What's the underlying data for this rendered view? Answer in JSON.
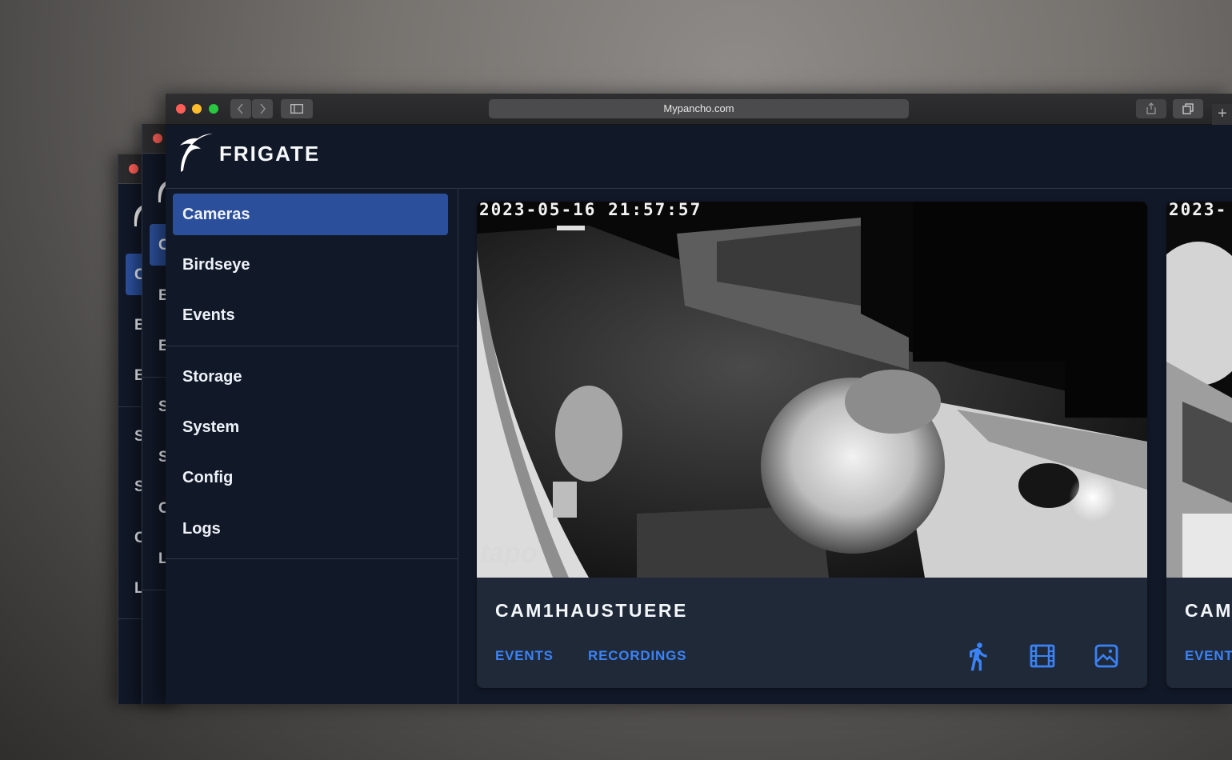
{
  "browser": {
    "url": "Mypancho.com",
    "back_icon": "chevron-left-icon",
    "forward_icon": "chevron-right-icon",
    "sidebar_toggle_icon": "sidebar-icon",
    "share_icon": "share-icon",
    "tabs_icon": "tabs-overview-icon",
    "new_tab_label": "+",
    "traffic_lights": {
      "close": "#ff5f57",
      "minimize": "#febc2e",
      "zoom": "#28c840"
    }
  },
  "app": {
    "name": "FRIGATE",
    "logo_icon": "frigate-bird-icon"
  },
  "colors": {
    "accent": "#3b82f6",
    "active_nav": "#2b4f9a",
    "background": "#111827",
    "card": "#1f2937"
  },
  "nav": {
    "items": [
      {
        "label": "Cameras",
        "active": true
      },
      {
        "label": "Birdseye"
      },
      {
        "label": "Events"
      },
      {
        "label": "Storage"
      },
      {
        "label": "System"
      },
      {
        "label": "Config"
      },
      {
        "label": "Logs"
      }
    ]
  },
  "cameras": [
    {
      "name": "CAM1HAUSTUERE",
      "timestamp": "2023-05-16  21:57:57",
      "watermark": "tapo",
      "events_label": "EVENTS",
      "recordings_label": "RECORDINGS",
      "icons": [
        "motion-person-icon",
        "film-icon",
        "image-icon"
      ]
    },
    {
      "name": "CAM",
      "timestamp": "2023-",
      "events_label": "EVENT"
    }
  ],
  "background_windows": {
    "back": {
      "letters": [
        "C",
        "B",
        "E",
        "S",
        "S",
        "C",
        "L"
      ]
    },
    "middle": {
      "letters": [
        "C",
        "B",
        "E",
        "S",
        "S",
        "C",
        "L"
      ]
    }
  }
}
